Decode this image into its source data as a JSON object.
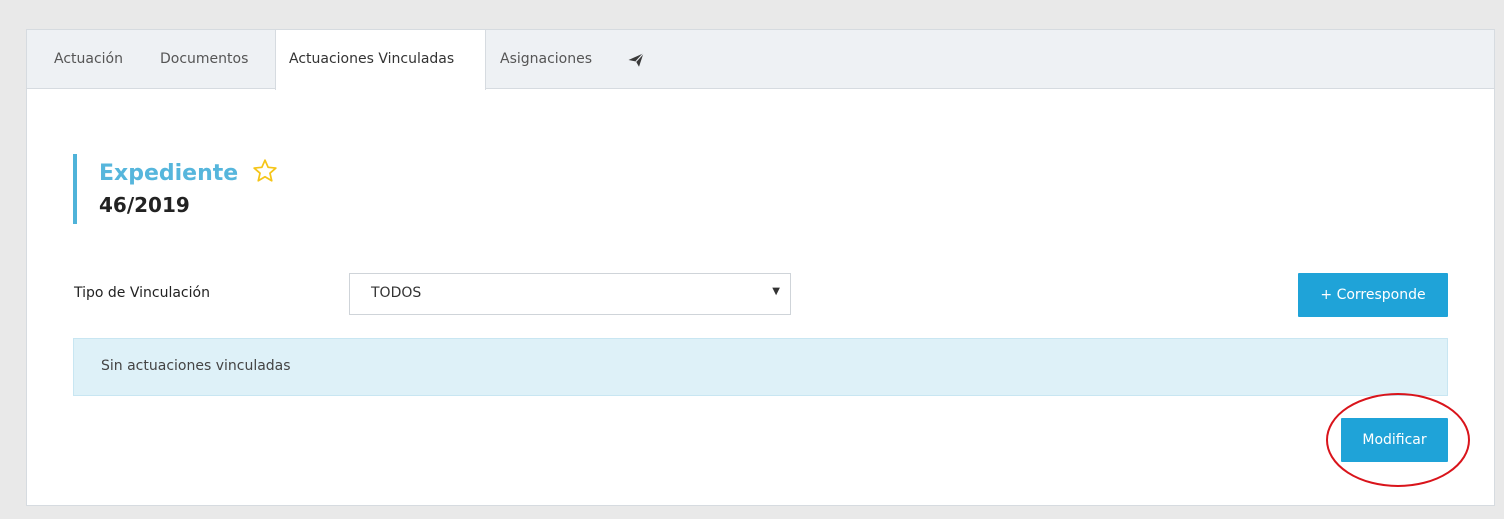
{
  "tabs": [
    {
      "label": "Actuación",
      "active": false
    },
    {
      "label": "Documentos",
      "active": false
    },
    {
      "label": "Actuaciones Vinculadas",
      "active": true
    },
    {
      "label": "Asignaciones",
      "active": false
    }
  ],
  "send_icon": "paper-plane-icon",
  "expediente": {
    "label": "Expediente",
    "number": "46/2019",
    "star_icon": "star-outline-icon"
  },
  "filter": {
    "label": "Tipo de Vinculación",
    "selected": "TODOS"
  },
  "buttons": {
    "corresponde": "+ Corresponde",
    "modificar": "Modificar"
  },
  "info_message": "Sin actuaciones vinculadas",
  "colors": {
    "accent": "#1fa3d8",
    "title": "#56b6dc",
    "info_bg": "#def1f8",
    "star": "#f5c518",
    "annotation": "#d9141b"
  }
}
